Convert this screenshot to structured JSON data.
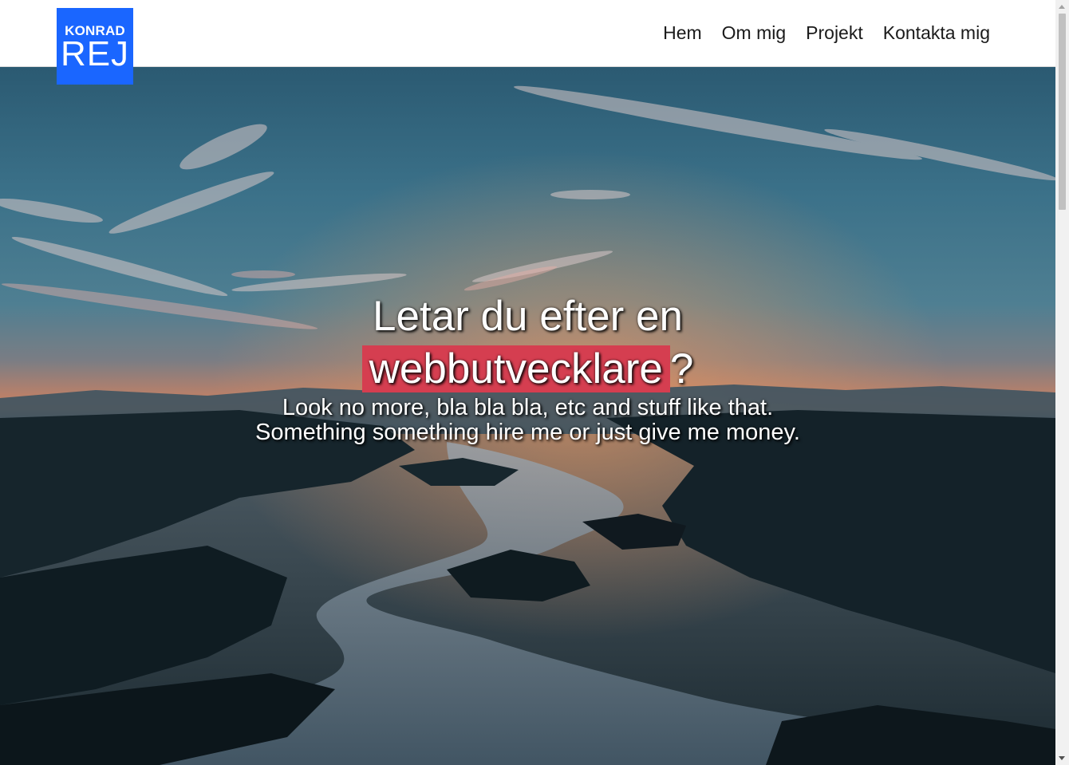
{
  "header": {
    "logo": {
      "top": "KONRAD",
      "bottom": "REJ"
    },
    "nav": [
      {
        "label": "Hem"
      },
      {
        "label": "Om mig"
      },
      {
        "label": "Projekt"
      },
      {
        "label": "Kontakta mig"
      }
    ]
  },
  "hero": {
    "headline_line1": "Letar du efter en",
    "headline_highlight": "webbutvecklare",
    "headline_suffix": "?",
    "subtext": "Look no more, bla bla bla, etc and stuff like that. Something something hire me or just give me money."
  },
  "colors": {
    "logo_bg": "#1a66ff",
    "highlight_bg": "#d53e50",
    "nav_text": "#1a1a1a"
  }
}
